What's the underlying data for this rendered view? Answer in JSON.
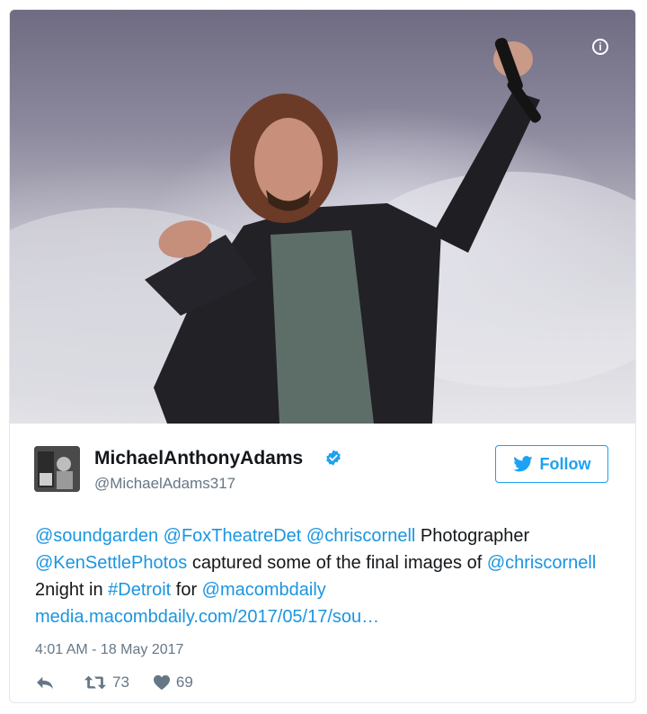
{
  "tweet": {
    "author": {
      "display_name": "MichaelAnthonyAdams",
      "handle": "@MichaelAdams317",
      "verified": true
    },
    "follow_label": "Follow",
    "text_parts": [
      {
        "t": "@soundgarden",
        "link": true
      },
      {
        "t": " ",
        "link": false
      },
      {
        "t": "@FoxTheatreDet",
        "link": true
      },
      {
        "t": " ",
        "link": false
      },
      {
        "t": "@chriscornell",
        "link": true
      },
      {
        "t": " Photographer ",
        "link": false
      },
      {
        "t": "@KenSettlePhotos",
        "link": true
      },
      {
        "t": " captured some of the final images of ",
        "link": false
      },
      {
        "t": "@chriscornell",
        "link": true
      },
      {
        "t": " 2night in ",
        "link": false
      },
      {
        "t": "#Detroit",
        "link": true
      },
      {
        "t": " for ",
        "link": false
      },
      {
        "t": "@macombdaily",
        "link": true
      },
      {
        "t": " ",
        "link": false
      },
      {
        "t": "media.macombdaily.com/2017/05/17/sou…",
        "link": true
      }
    ],
    "timestamp": "4:01 AM - 18 May 2017",
    "retweets": "73",
    "likes": "69",
    "icons": {
      "info": "info-icon",
      "verified": "verified-badge-icon",
      "follow": "twitter-bird-icon",
      "reply": "reply-icon",
      "retweet": "retweet-icon",
      "like": "heart-icon"
    },
    "colors": {
      "link": "#1b95e0",
      "accent": "#1da1f2",
      "muted": "#657786",
      "text": "#14171a"
    }
  }
}
